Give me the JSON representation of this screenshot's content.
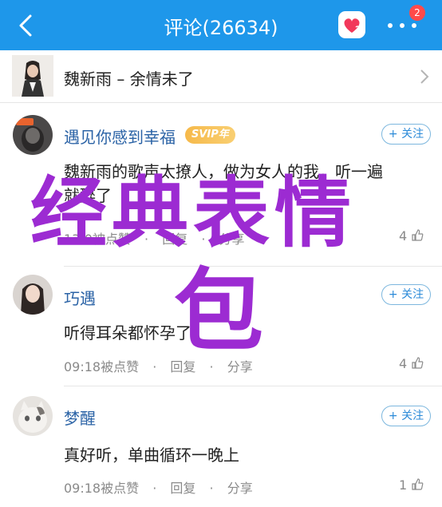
{
  "header": {
    "title": "评论(26634)",
    "badge_count": "2",
    "back_icon": "chevron-left-icon",
    "heart_icon": "heart-icon",
    "more_icon": "more-dots-icon",
    "color": "#1e97ea"
  },
  "song": {
    "title": "魏新雨 – 余情未了"
  },
  "comments": [
    {
      "username": "遇见你感到幸福",
      "vip_badge": "SVIP年",
      "follow_label": "+ 关注",
      "text_line1": "魏新雨的歌声太撩人，做为女人的我，听一遍",
      "text_line2": "就醉了",
      "time": "13:0",
      "like_label": "被点赞",
      "reply_label": "回复",
      "share_label": "分享",
      "likes": "4"
    },
    {
      "username": "巧遇",
      "follow_label": "+ 关注",
      "text_line1": "听得耳朵都怀孕了",
      "time": "09:18",
      "like_label": "被点赞",
      "reply_label": "回复",
      "share_label": "分享",
      "likes": "4"
    },
    {
      "username": "梦醒",
      "follow_label": "+ 关注",
      "text_line1": "真好听，单曲循环一晚上",
      "time": "09:18",
      "like_label": "被点赞",
      "reply_label": "回复",
      "share_label": "分享",
      "likes": "1"
    }
  ],
  "overlay": {
    "line1": "经典表情",
    "line2": "包",
    "color": "#9c2bd2"
  },
  "dot": "·"
}
